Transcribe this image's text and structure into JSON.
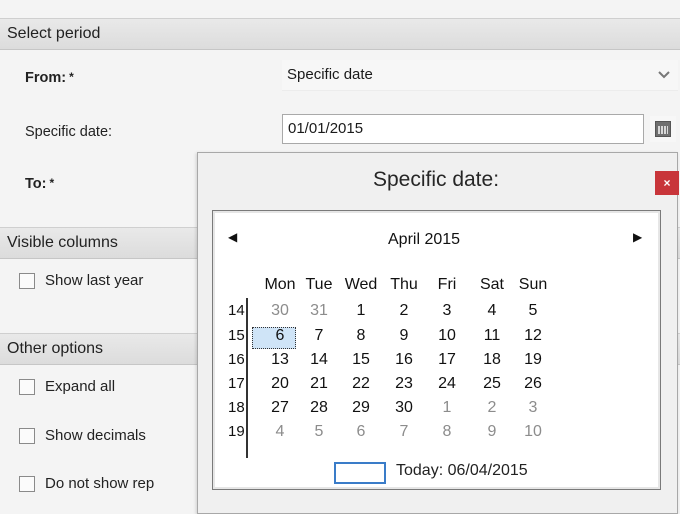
{
  "period": {
    "section_title": "Select period",
    "from_label": "From:",
    "required_mark": "*",
    "from_value": "Specific date",
    "specific_date_label": "Specific date:",
    "specific_date_value": "01/01/2015",
    "to_label": "To:"
  },
  "columns": {
    "section_title": "Visible columns",
    "show_last_year": "Show last year"
  },
  "options": {
    "section_title": "Other options",
    "expand_all": "Expand all",
    "show_decimals": "Show decimals",
    "do_not_show": "Do not show rep"
  },
  "popup": {
    "title": "Specific date:",
    "close_glyph": "×",
    "close_color": "#c8353a"
  },
  "calendar": {
    "prev_glyph": "◀",
    "next_glyph": "▶",
    "month": "April 2015",
    "weekdays": [
      "Mon",
      "Tue",
      "Wed",
      "Thu",
      "Fri",
      "Sat",
      "Sun"
    ],
    "weeks": [
      {
        "num": "14",
        "days": [
          [
            "30",
            false
          ],
          [
            "31",
            false
          ],
          [
            "1",
            true
          ],
          [
            "2",
            true
          ],
          [
            "3",
            true
          ],
          [
            "4",
            true
          ],
          [
            "5",
            true
          ]
        ]
      },
      {
        "num": "15",
        "days": [
          [
            "6",
            true
          ],
          [
            "7",
            true
          ],
          [
            "8",
            true
          ],
          [
            "9",
            true
          ],
          [
            "10",
            true
          ],
          [
            "11",
            true
          ],
          [
            "12",
            true
          ]
        ]
      },
      {
        "num": "16",
        "days": [
          [
            "13",
            true
          ],
          [
            "14",
            true
          ],
          [
            "15",
            true
          ],
          [
            "16",
            true
          ],
          [
            "17",
            true
          ],
          [
            "18",
            true
          ],
          [
            "19",
            true
          ]
        ]
      },
      {
        "num": "17",
        "days": [
          [
            "20",
            true
          ],
          [
            "21",
            true
          ],
          [
            "22",
            true
          ],
          [
            "23",
            true
          ],
          [
            "24",
            true
          ],
          [
            "25",
            true
          ],
          [
            "26",
            true
          ]
        ]
      },
      {
        "num": "18",
        "days": [
          [
            "27",
            true
          ],
          [
            "28",
            true
          ],
          [
            "29",
            true
          ],
          [
            "30",
            true
          ],
          [
            "1",
            false
          ],
          [
            "2",
            false
          ],
          [
            "3",
            false
          ]
        ]
      },
      {
        "num": "19",
        "days": [
          [
            "4",
            false
          ],
          [
            "5",
            false
          ],
          [
            "6",
            false
          ],
          [
            "7",
            false
          ],
          [
            "8",
            false
          ],
          [
            "9",
            false
          ],
          [
            "10",
            false
          ]
        ]
      }
    ],
    "selected_day": "6",
    "today_label": "Today: 06/04/2015",
    "accent_color": "#3a7cc8"
  }
}
